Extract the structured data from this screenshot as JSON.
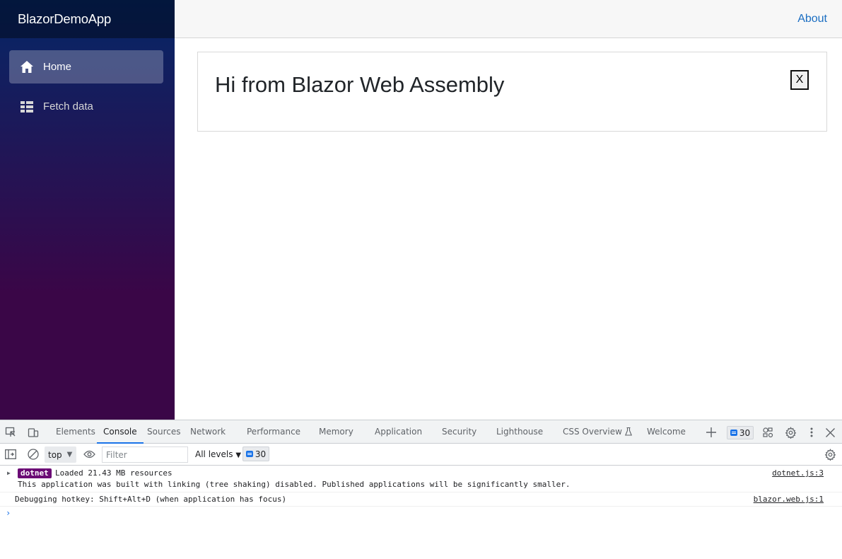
{
  "app": {
    "brand": "BlazorDemoApp",
    "nav": [
      {
        "label": "Home",
        "icon": "home-icon",
        "active": true
      },
      {
        "label": "Fetch data",
        "icon": "list-icon",
        "active": false
      }
    ],
    "about_link": "About"
  },
  "main": {
    "card_title": "Hi from Blazor Web Assembly",
    "close_label": "X"
  },
  "devtools": {
    "tabs": [
      "Elements",
      "Console",
      "Sources",
      "Network",
      "Performance",
      "Memory",
      "Application",
      "Security",
      "Lighthouse",
      "CSS Overview",
      "Welcome"
    ],
    "active_tab": "Console",
    "issues_count": "30",
    "context": "top",
    "filter_placeholder": "Filter",
    "levels_label": "All levels",
    "messages_count": "30",
    "messages": [
      {
        "tag": "dotnet",
        "line1": "Loaded 21.43 MB resources",
        "line2": "This application was built with linking (tree shaking) disabled. Published applications will be significantly smaller.",
        "source": "dotnet.js:3"
      },
      {
        "text": "Debugging hotkey: Shift+Alt+D (when application has focus)",
        "source": "blazor.web.js:1"
      }
    ],
    "prompt": "›"
  },
  "colors": {
    "sidebar_top": "#052767",
    "sidebar_bottom": "#3a0647",
    "link": "#1b6ec2",
    "tag_bg": "#6b0b75",
    "devtools_accent": "#1a73e8"
  }
}
